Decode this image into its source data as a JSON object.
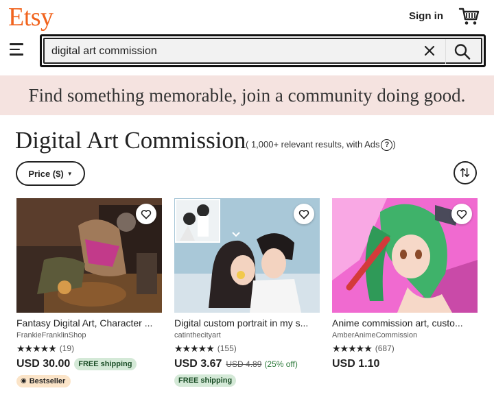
{
  "header": {
    "logo": "Etsy",
    "sign_in": "Sign in",
    "cart_icon": "cart-icon",
    "menu_icon": "hamburger-menu-icon"
  },
  "search": {
    "value": "digital art commission",
    "clear_icon": "close-icon",
    "submit_icon": "search-icon"
  },
  "banner": {
    "text": "Find something memorable, join a community doing good."
  },
  "results": {
    "title": "Digital Art Commission",
    "info": "( 1,000+ relevant results,  with Ads",
    "help_icon": "?",
    "info_close": ")"
  },
  "filters": {
    "price_label": "Price ($)",
    "sort_icon": "sort-arrows-icon"
  },
  "listings": [
    {
      "title": "Fantasy Digital Art, Character ...",
      "shop": "FrankieFranklinShop",
      "stars": "★★★★★",
      "rating_count": "(19)",
      "price": "USD 30.00",
      "shipping": "FREE shipping",
      "bestseller": "Bestseller"
    },
    {
      "title": "Digital custom portrait in my s...",
      "shop": "catinthecityart",
      "stars": "★★★★★",
      "rating_count": "(155)",
      "price": "USD 3.67",
      "original_price": "USD 4.89",
      "discount": "(25% off)",
      "shipping": "FREE shipping"
    },
    {
      "title": "Anime commission art, custo...",
      "shop": "AmberAnimeCommission",
      "stars": "★★★★★",
      "rating_count": "(687)",
      "price": "USD 1.10"
    }
  ],
  "colors": {
    "brand": "#F1641E",
    "banner_bg": "#f5e3e0",
    "free_shipping_bg": "#d4e9d7",
    "bestseller_bg": "#fbe4c8"
  }
}
